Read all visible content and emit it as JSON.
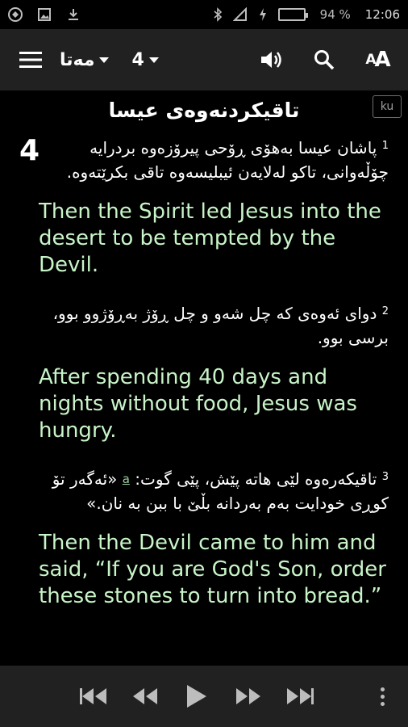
{
  "status_bar": {
    "battery_percent": "94 %",
    "time": "12:06",
    "battery_level": 0.94,
    "icons": [
      "app-icon",
      "image-icon",
      "download-icon",
      "bluetooth-icon",
      "signal-icon",
      "charging-icon",
      "battery-icon"
    ]
  },
  "toolbar": {
    "book": "مەتا",
    "chapter": "4",
    "icons": [
      "menu-icon",
      "speaker-icon",
      "search-icon",
      "text-size-icon"
    ],
    "text_size_label": "AA"
  },
  "content": {
    "language_badge": "ku",
    "heading": "تاقیکردنەوەی عیسا",
    "chapter_number": "4",
    "verses": [
      {
        "num": "1",
        "ku": "پاشان عیسا بەهۆی ڕۆحی پیرۆزەوە بردرایە چۆڵەوانی، تاکو لەلایەن ئیبلیسەوە تاقی بکرێتەوە.",
        "en": "Then the Spirit led Jesus into the desert to be tempted by the Devil."
      },
      {
        "num": "2",
        "ku": "دوای ئەوەی کە چل شەو و چل ڕۆژ بەڕۆژوو بوو، برسی بوو.",
        "en": "After spending 40 days and nights without food, Jesus was hungry."
      },
      {
        "num": "3",
        "ku_before_link": "تاقیکەرەوە لێی هاتە پێش، پێی گوت:",
        "link": "a",
        "ku_after_link": "«ئەگەر تۆ کوڕی خودایت بەم بەردانە بڵێ با ببن بە نان.»",
        "en": "Then the Devil came to him and said, “If you are God's Son, order these stones to turn into bread.”"
      }
    ]
  },
  "player": {
    "icons": [
      "skip-previous-icon",
      "rewind-icon",
      "play-icon",
      "fast-forward-icon",
      "skip-next-icon",
      "more-vert-icon"
    ]
  },
  "colors": {
    "background": "#000000",
    "bar": "#212121",
    "english_text": "#c8f4c8",
    "battery": "#2ecc40"
  }
}
